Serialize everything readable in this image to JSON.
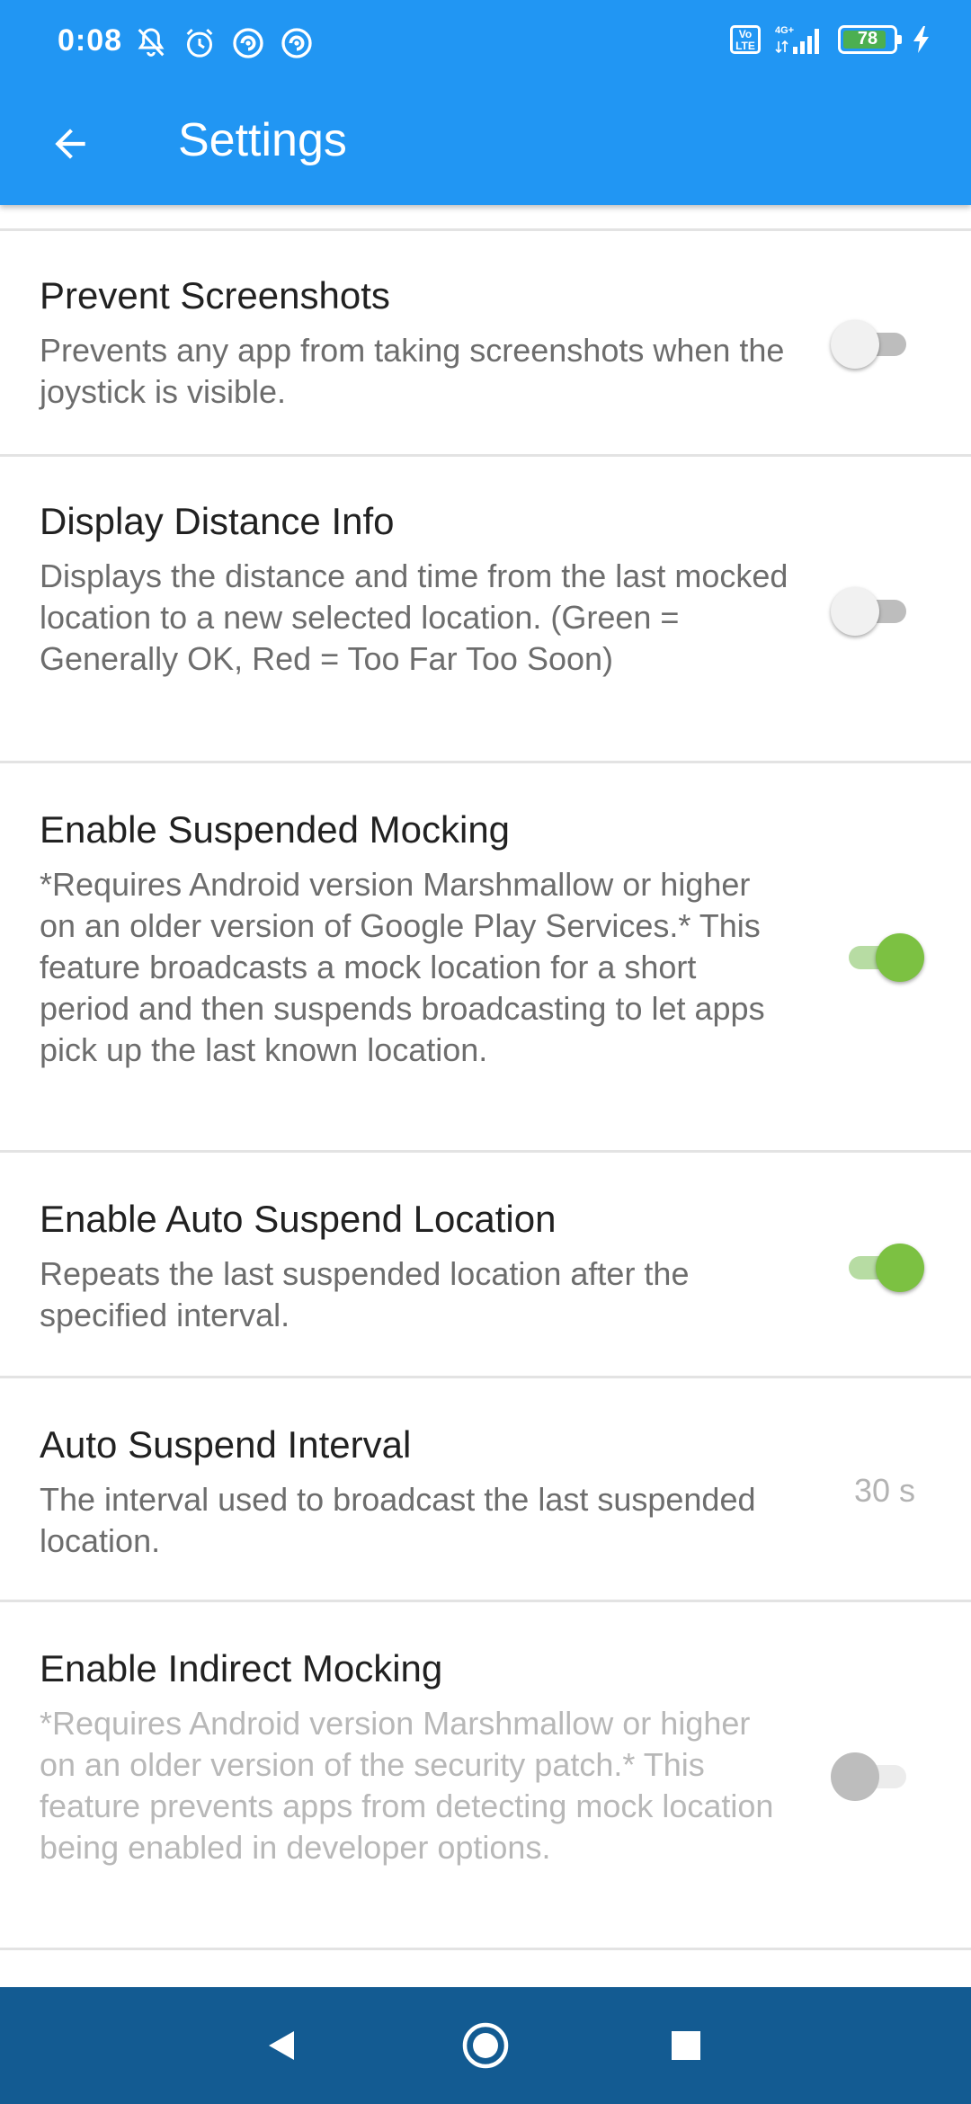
{
  "status_bar": {
    "time": "0:08",
    "icons_left": [
      "notifications-muted-icon",
      "alarm-icon",
      "app-notification-icon",
      "app-notification-icon"
    ],
    "volte": "Vo LTE",
    "network": "4G+",
    "battery_level": "78",
    "charging": true
  },
  "app_bar": {
    "back_icon": "arrow-back-icon",
    "title": "Settings"
  },
  "settings": [
    {
      "title": "Prevent Screenshots",
      "summary": "Prevents any app from taking screenshots when the joystick is visible.",
      "control": "switch",
      "checked": false
    },
    {
      "title": "Display Distance Info",
      "summary": "Displays the distance and time from the last mocked location to a new selected location. (Green = Generally OK, Red = Too Far Too Soon)",
      "control": "switch",
      "checked": false
    },
    {
      "title": "Enable Suspended Mocking",
      "summary": "*Requires Android version Marshmallow or higher on an older version of Google Play Services.* This feature broadcasts a mock location for a short period and then suspends broadcasting to let apps pick up the last known location.",
      "control": "switch",
      "checked": true
    },
    {
      "title": "Enable Auto Suspend Location",
      "summary": "Repeats the last suspended location after the specified interval.",
      "control": "switch",
      "checked": true
    },
    {
      "title": "Auto Suspend Interval",
      "summary": "The interval used to broadcast the last suspended location.",
      "control": "value",
      "value": "30 s"
    },
    {
      "title": "Enable Indirect Mocking",
      "summary": "*Requires Android version Marshmallow or higher on an older version of the security patch.* This feature prevents apps from detecting mock location being enabled in developer options.",
      "control": "switch",
      "checked": false,
      "enabled": false
    }
  ],
  "nav_bar": {
    "buttons": [
      "back-triangle-icon",
      "home-circle-icon",
      "recents-square-icon"
    ]
  },
  "colors": {
    "app_bar": "#2196f3",
    "switch_on": "#7cc142",
    "nav_bar": "#135b92"
  }
}
